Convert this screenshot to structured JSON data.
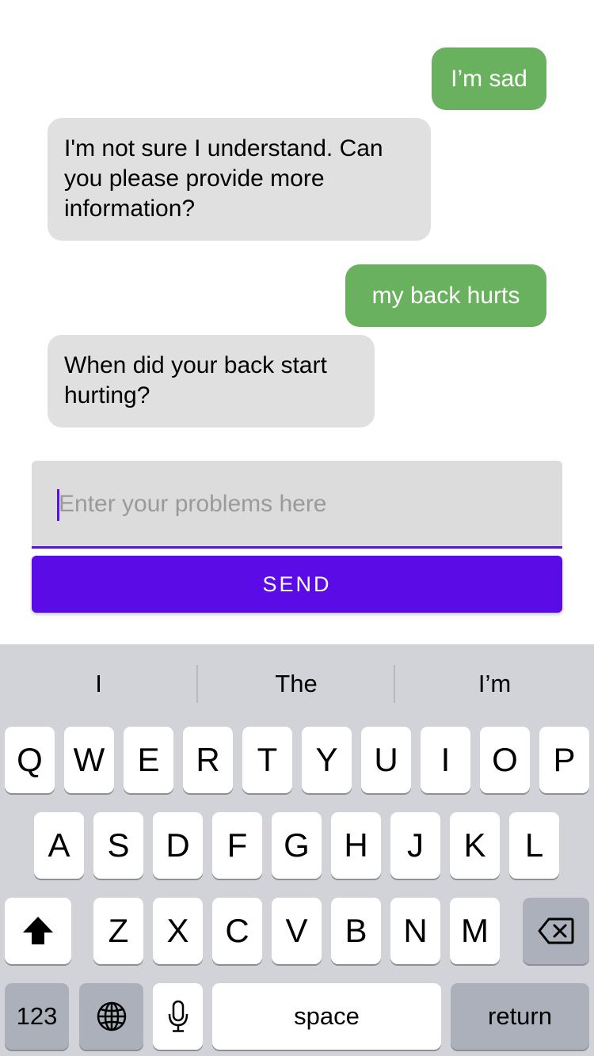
{
  "messages": [
    {
      "sender": "user",
      "text": "I’m sad"
    },
    {
      "sender": "bot",
      "lines": [
        "I'm not sure I understand. Can",
        "you please provide more",
        "information?"
      ]
    },
    {
      "sender": "user",
      "text": "my back hurts"
    },
    {
      "sender": "bot",
      "lines": [
        "When did your back start",
        "hurting?"
      ]
    }
  ],
  "input": {
    "placeholder": "Enter your problems here",
    "value": ""
  },
  "send_button": {
    "label": "SEND"
  },
  "colors": {
    "accent": "#5b0ce6",
    "user_bubble": "#69b05f",
    "bot_bubble": "#e0e0e0",
    "keyboard_bg": "#d1d3d9"
  },
  "keyboard": {
    "suggestions": [
      "I",
      "The",
      "I’m"
    ],
    "row1": [
      "Q",
      "W",
      "E",
      "R",
      "T",
      "Y",
      "U",
      "I",
      "O",
      "P"
    ],
    "row2": [
      "A",
      "S",
      "D",
      "F",
      "G",
      "H",
      "J",
      "K",
      "L"
    ],
    "row3": [
      "Z",
      "X",
      "C",
      "V",
      "B",
      "N",
      "M"
    ],
    "numbers_label": "123",
    "space_label": "space",
    "return_label": "return",
    "icons": {
      "shift": "shift-icon",
      "delete": "delete-icon",
      "globe": "globe-icon",
      "mic": "microphone-icon"
    }
  }
}
